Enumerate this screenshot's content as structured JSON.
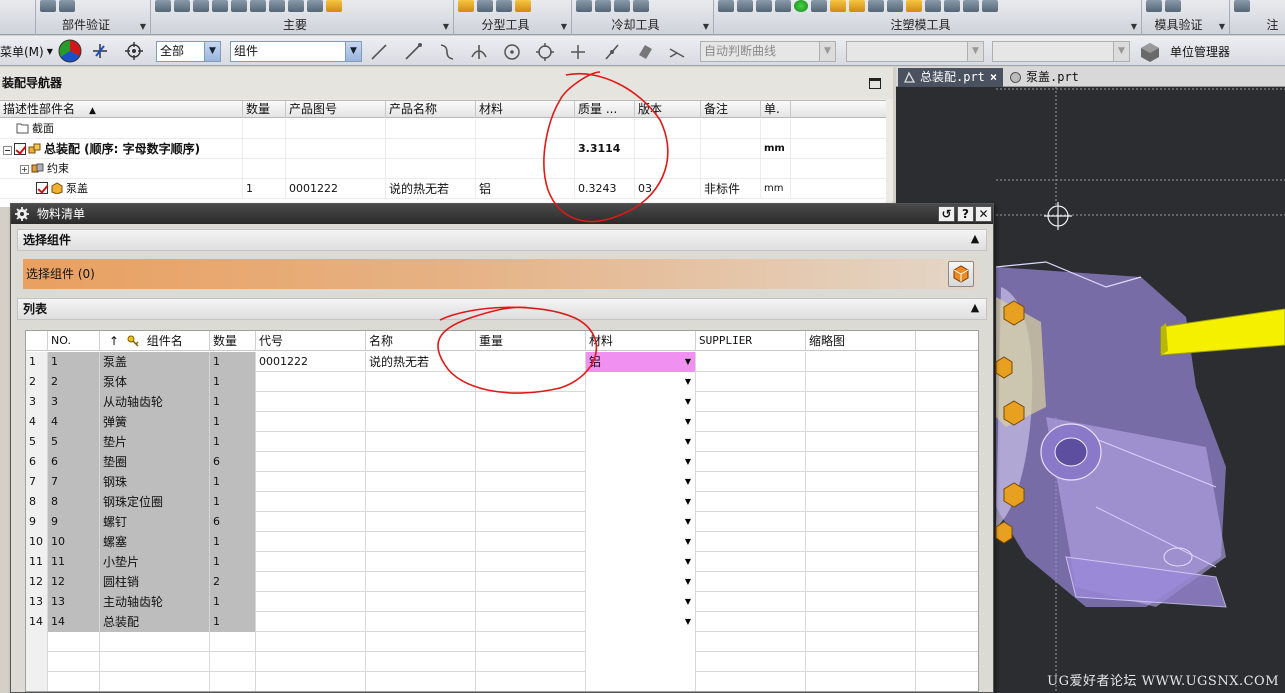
{
  "ribbon": {
    "groups": [
      {
        "label": "部件验证"
      },
      {
        "label": "主要"
      },
      {
        "label": "分型工具"
      },
      {
        "label": "冷却工具"
      },
      {
        "label": "注塑模工具"
      },
      {
        "label": "模具验证"
      },
      {
        "label": "注"
      }
    ]
  },
  "toolbar": {
    "menu_label": "菜单(M)",
    "filter_scope": "全部",
    "selection_filter": "组件",
    "curve_rule": "自动判断曲线",
    "unit_manager": "单位管理器"
  },
  "assembly_navigator": {
    "title": "装配导航器",
    "columns": [
      "描述性部件名",
      "数量",
      "产品图号",
      "产品名称",
      "材料",
      "质量 ...",
      "版本",
      "备注",
      "单."
    ],
    "rows": [
      {
        "name": "截面",
        "qty": "",
        "drawing_no": "",
        "product_name": "",
        "material": "",
        "mass": "",
        "version": "",
        "note": "",
        "unit": ""
      },
      {
        "name": "总装配 (顺序: 字母数字顺序)",
        "qty": "",
        "drawing_no": "",
        "product_name": "",
        "material": "",
        "mass": "3.3114",
        "version": "",
        "note": "",
        "unit": "mm"
      },
      {
        "name": "约束",
        "qty": "",
        "drawing_no": "",
        "product_name": "",
        "material": "",
        "mass": "",
        "version": "",
        "note": "",
        "unit": ""
      },
      {
        "name": "泵盖",
        "qty": "1",
        "drawing_no": "0001222",
        "product_name": "说的热无若",
        "material": "铝",
        "mass": "0.3243",
        "version": "03",
        "note": "非标件",
        "unit": "mm"
      }
    ]
  },
  "graphics": {
    "tabs": [
      {
        "label": "总装配.prt",
        "close": "×"
      },
      {
        "label": "泵盖.prt"
      }
    ],
    "watermark": "UG爱好者论坛 WWW.UGSNX.COM"
  },
  "bom_dialog": {
    "title": "物料清单",
    "section_select": "选择组件",
    "select_label": "选择组件 (0)",
    "section_list": "列表",
    "columns": [
      "NO.",
      "组件名",
      "数量",
      "代号",
      "名称",
      "重量",
      "材料",
      "SUPPLIER",
      "缩略图"
    ],
    "rows": [
      {
        "rn": "1",
        "no": "1",
        "name": "泵盖",
        "qty": "1",
        "code": "0001222",
        "title": "说的热无若",
        "weight": "",
        "material": "铝"
      },
      {
        "rn": "2",
        "no": "2",
        "name": "泵体",
        "qty": "1",
        "code": "",
        "title": "",
        "weight": "",
        "material": ""
      },
      {
        "rn": "3",
        "no": "3",
        "name": "从动轴齿轮",
        "qty": "1",
        "code": "",
        "title": "",
        "weight": "",
        "material": ""
      },
      {
        "rn": "4",
        "no": "4",
        "name": "弹簧",
        "qty": "1",
        "code": "",
        "title": "",
        "weight": "",
        "material": ""
      },
      {
        "rn": "5",
        "no": "5",
        "name": "垫片",
        "qty": "1",
        "code": "",
        "title": "",
        "weight": "",
        "material": ""
      },
      {
        "rn": "6",
        "no": "6",
        "name": "垫圈",
        "qty": "6",
        "code": "",
        "title": "",
        "weight": "",
        "material": ""
      },
      {
        "rn": "7",
        "no": "7",
        "name": "钢珠",
        "qty": "1",
        "code": "",
        "title": "",
        "weight": "",
        "material": ""
      },
      {
        "rn": "8",
        "no": "8",
        "name": "钢珠定位圈",
        "qty": "1",
        "code": "",
        "title": "",
        "weight": "",
        "material": ""
      },
      {
        "rn": "9",
        "no": "9",
        "name": "螺钉",
        "qty": "6",
        "code": "",
        "title": "",
        "weight": "",
        "material": ""
      },
      {
        "rn": "10",
        "no": "10",
        "name": "螺塞",
        "qty": "1",
        "code": "",
        "title": "",
        "weight": "",
        "material": ""
      },
      {
        "rn": "11",
        "no": "11",
        "name": "小垫片",
        "qty": "1",
        "code": "",
        "title": "",
        "weight": "",
        "material": ""
      },
      {
        "rn": "12",
        "no": "12",
        "name": "圆柱销",
        "qty": "2",
        "code": "",
        "title": "",
        "weight": "",
        "material": ""
      },
      {
        "rn": "13",
        "no": "13",
        "name": "主动轴齿轮",
        "qty": "1",
        "code": "",
        "title": "",
        "weight": "",
        "material": ""
      },
      {
        "rn": "14",
        "no": "14",
        "name": "总装配",
        "qty": "1",
        "code": "",
        "title": "",
        "weight": "",
        "material": ""
      }
    ]
  },
  "colors": {
    "material_highlight": "#f090f0",
    "select_bar": "#e9a060",
    "annotation": "#e01818"
  }
}
